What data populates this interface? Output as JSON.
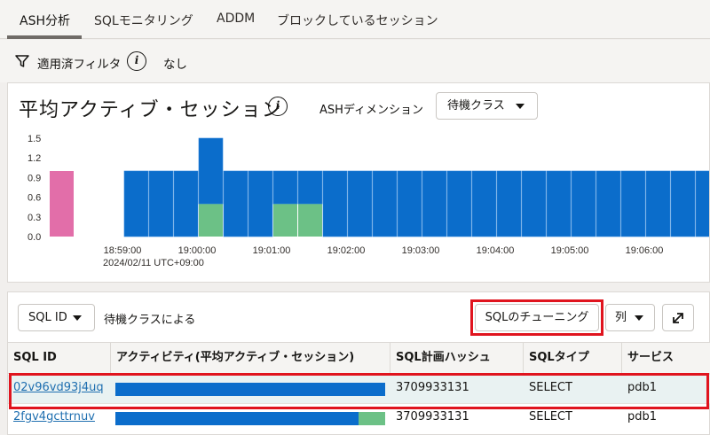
{
  "tabs": [
    {
      "label": "ASH分析",
      "active": true
    },
    {
      "label": "SQLモニタリング",
      "active": false
    },
    {
      "label": "ADDM",
      "active": false
    },
    {
      "label": "ブロックしているセッション",
      "active": false
    }
  ],
  "filter": {
    "label": "適用済フィルタ",
    "value": "なし"
  },
  "chart_panel": {
    "title": "平均アクティブ・セッション",
    "dimension_label": "ASHディメンション",
    "dimension_value": "待機クラス"
  },
  "chart_data": {
    "type": "bar",
    "stacked": true,
    "ylim": [
      0,
      1.5
    ],
    "yticks": [
      "1.5",
      "1.2",
      "0.9",
      "0.6",
      "0.3",
      "0.0"
    ],
    "xticks": [
      "18:59:00",
      "19:00:00",
      "19:01:00",
      "19:02:00",
      "19:03:00",
      "19:04:00",
      "19:05:00",
      "19:06:00"
    ],
    "date_label": "2024/02/11 UTC+09:00",
    "colors": {
      "blue": "#0b6dcb",
      "green": "#6cc186",
      "pink": "#e26ea9"
    },
    "bars": [
      {
        "blue": 0,
        "green": 0,
        "pink": 1.0
      },
      {
        "blue": 0,
        "green": 0,
        "pink": 0
      },
      {
        "blue": 0,
        "green": 0,
        "pink": 0
      },
      {
        "blue": 1.0,
        "green": 0,
        "pink": 0
      },
      {
        "blue": 1.0,
        "green": 0,
        "pink": 0
      },
      {
        "blue": 1.0,
        "green": 0,
        "pink": 0
      },
      {
        "blue": 1.0,
        "green": 0.5,
        "pink": 0
      },
      {
        "blue": 1.0,
        "green": 0,
        "pink": 0
      },
      {
        "blue": 1.0,
        "green": 0,
        "pink": 0
      },
      {
        "blue": 0.5,
        "green": 0.5,
        "pink": 0
      },
      {
        "blue": 0.5,
        "green": 0.5,
        "pink": 0
      },
      {
        "blue": 1.0,
        "green": 0,
        "pink": 0
      },
      {
        "blue": 1.0,
        "green": 0,
        "pink": 0
      },
      {
        "blue": 1.0,
        "green": 0,
        "pink": 0
      },
      {
        "blue": 1.0,
        "green": 0,
        "pink": 0
      },
      {
        "blue": 1.0,
        "green": 0,
        "pink": 0
      },
      {
        "blue": 1.0,
        "green": 0,
        "pink": 0
      },
      {
        "blue": 1.0,
        "green": 0,
        "pink": 0
      },
      {
        "blue": 1.0,
        "green": 0,
        "pink": 0
      },
      {
        "blue": 1.0,
        "green": 0,
        "pink": 0
      },
      {
        "blue": 1.0,
        "green": 0,
        "pink": 0
      },
      {
        "blue": 1.0,
        "green": 0,
        "pink": 0
      },
      {
        "blue": 1.0,
        "green": 0,
        "pink": 0
      },
      {
        "blue": 1.0,
        "green": 0,
        "pink": 0
      },
      {
        "blue": 1.0,
        "green": 0,
        "pink": 0
      },
      {
        "blue": 1.0,
        "green": 0,
        "pink": 0
      },
      {
        "blue": 1.0,
        "green": 0,
        "pink": 0
      },
      {
        "blue": 1.0,
        "green": 0,
        "pink": 0
      }
    ]
  },
  "sql_panel": {
    "group_select": "SQL ID",
    "group_label": "待機クラスによる",
    "tune_button": "SQLのチューニング",
    "columns_button": "列",
    "columns": [
      "SQL ID",
      "アクティビティ(平均アクティブ・セッション)",
      "SQL計画ハッシュ",
      "SQLタイプ",
      "サービス"
    ],
    "rows": [
      {
        "sql_id": "02v96vd93j4uq",
        "blue": 1.0,
        "green": 0.0,
        "plan_hash": "3709933131",
        "type": "SELECT",
        "service": "pdb1"
      },
      {
        "sql_id": "2fgv4gcttrnuv",
        "blue": 0.9,
        "green": 0.1,
        "plan_hash": "3709933131",
        "type": "SELECT",
        "service": "pdb1"
      }
    ]
  }
}
